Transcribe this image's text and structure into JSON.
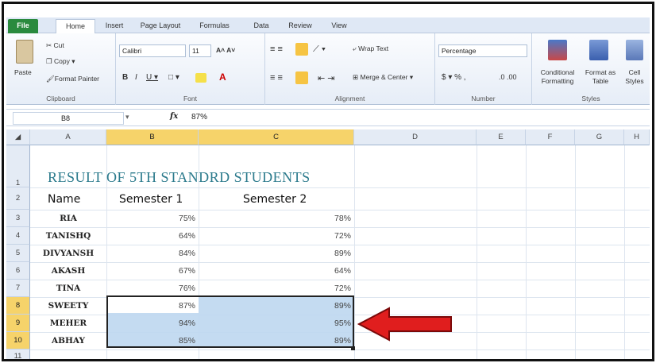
{
  "ribbon": {
    "tabs": [
      "File",
      "Home",
      "Insert",
      "Page Layout",
      "Formulas",
      "Data",
      "Review",
      "View"
    ],
    "clipboard": {
      "paste": "Paste",
      "cut": "Cut",
      "copy": "Copy",
      "format_painter": "Format Painter",
      "group_label": "Clipboard"
    },
    "font": {
      "name": "Calibri",
      "size": "11",
      "group_label": "Font"
    },
    "alignment": {
      "wrap_text": "Wrap Text",
      "merge_center": "Merge & Center",
      "group_label": "Alignment"
    },
    "number": {
      "format": "Percentage",
      "group_label": "Number"
    },
    "styles": {
      "conditional": "Conditional Formatting",
      "format_table": "Format as Table",
      "cell_styles": "Cell Styles",
      "group_label": "Styles"
    }
  },
  "formula_bar": {
    "name_box": "B8",
    "fx": "fx",
    "content": "87%"
  },
  "sheet": {
    "columns": [
      "A",
      "B",
      "C",
      "D",
      "E",
      "F",
      "G",
      "H"
    ],
    "rows": [
      "1",
      "2",
      "3",
      "4",
      "5",
      "6",
      "7",
      "8",
      "9",
      "10",
      "11"
    ],
    "title": "RESULT OF 5TH STANDRD STUDENTS",
    "headers": {
      "name": "Name",
      "sem1": "Semester 1",
      "sem2": "Semester 2"
    },
    "students": [
      {
        "name": "RIA",
        "sem1": "75%",
        "sem2": "78%"
      },
      {
        "name": "TANISHQ",
        "sem1": "64%",
        "sem2": "72%"
      },
      {
        "name": "DIVYANSH",
        "sem1": "84%",
        "sem2": "89%"
      },
      {
        "name": "AKASH",
        "sem1": "67%",
        "sem2": "64%"
      },
      {
        "name": "TINA",
        "sem1": "76%",
        "sem2": "72%"
      },
      {
        "name": "SWEETY",
        "sem1": "87%",
        "sem2": "89%"
      },
      {
        "name": "MEHER",
        "sem1": "94%",
        "sem2": "95%"
      },
      {
        "name": "ABHAY",
        "sem1": "85%",
        "sem2": "89%"
      }
    ]
  },
  "colors": {
    "title": "#2b7a8c",
    "selection": "#bed7f0",
    "arrow": "#e01e1e",
    "file_tab": "#2a8a3e"
  }
}
